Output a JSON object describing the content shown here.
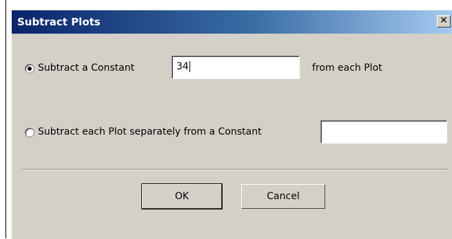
{
  "window": {
    "title": "Subtract Plots",
    "close_label": "✕"
  },
  "options": {
    "constant": {
      "label": "Subtract a Constant",
      "value": "34",
      "suffix": "from each Plot",
      "selected": true
    },
    "separately": {
      "label": "Subtract each Plot separately from a Constant",
      "value": "",
      "selected": false
    }
  },
  "buttons": {
    "ok_label": "OK",
    "cancel_label": "Cancel"
  }
}
